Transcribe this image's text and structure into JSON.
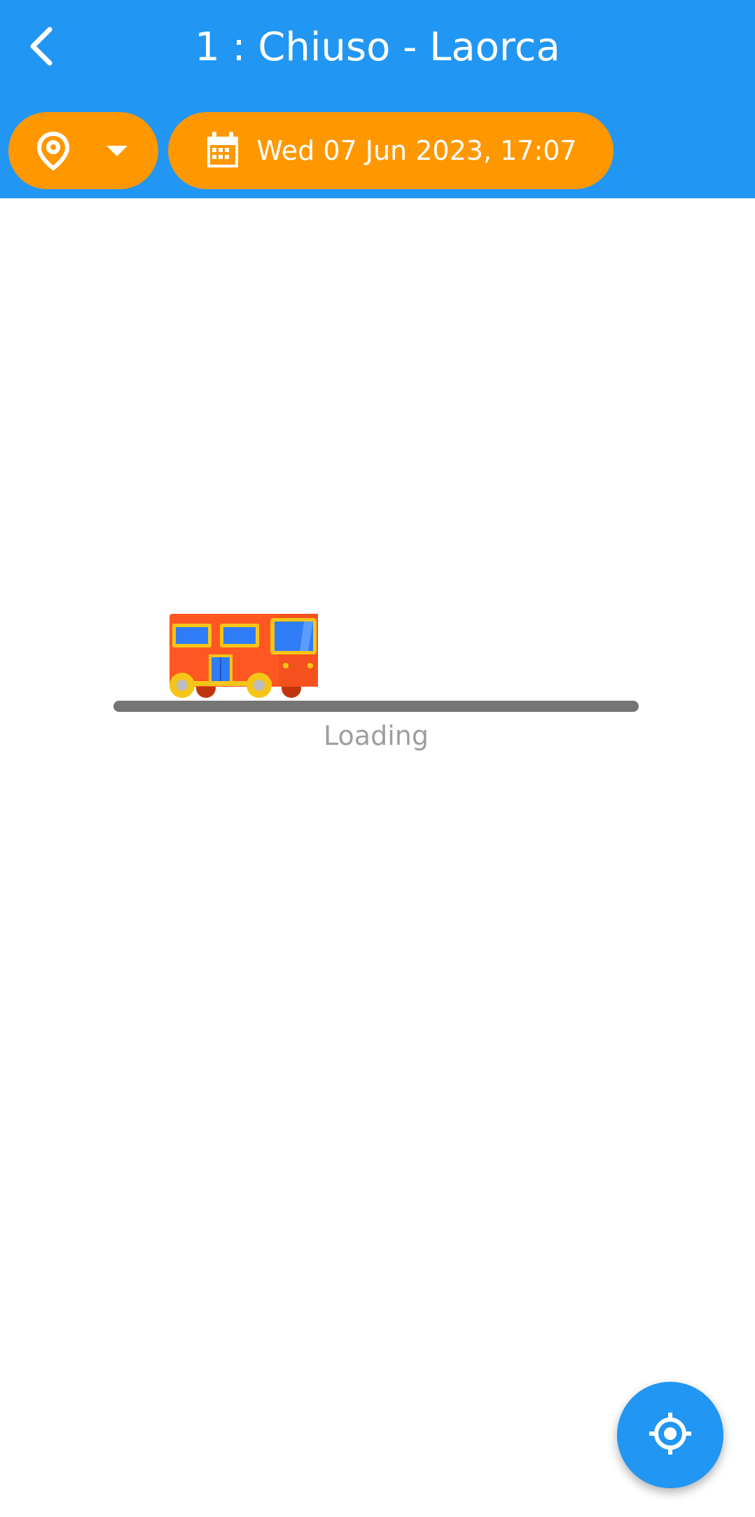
{
  "header": {
    "title": "1 : Chiuso - Laorca",
    "back_icon": "chevron-left-icon"
  },
  "filters": {
    "location_icon": "map-pin-icon",
    "dropdown_icon": "caret-down-icon",
    "calendar_icon": "calendar-icon",
    "date_label": "Wed 07 Jun 2023, 17:07"
  },
  "loader": {
    "text": "Loading",
    "illustration": "bus-illustration"
  },
  "fab": {
    "icon": "my-location-icon"
  },
  "colors": {
    "primary": "#2196F3",
    "accent": "#FF9800",
    "road": "#757575",
    "loading_text": "#9E9E9E"
  }
}
